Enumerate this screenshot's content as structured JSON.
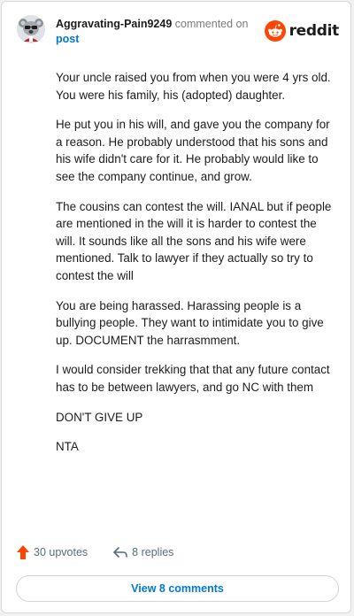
{
  "header": {
    "username": "Aggravating-Pain9249",
    "commented_text": "commented on",
    "post_link": "post",
    "brand": "reddit"
  },
  "comment": {
    "paragraphs": [
      "Your uncle raised you from when you were 4 yrs old. You were his family, his (adopted) daughter.",
      "He put you in his will, and gave you the company for a reason. He probably understood that his sons and his wife didn't care for it. He probably would like to see the company continue, and grow.",
      "The cousins can contest the will. IANAL but if people are mentioned in the will it is harder to contest the will. It sounds like all the sons and his wife were mentioned. Talk to lawyer if they actually so try to contest the will",
      "You are being harassed. Harassing people is a bullying people. They want to intimidate you to give up. DOCUMENT the harrasmment.",
      "I would consider trekking that that any future contact has to be between lawyers, and go NC with them",
      "DON'T GIVE UP",
      "NTA"
    ]
  },
  "actions": {
    "upvotes": "30 upvotes",
    "replies": "8 replies",
    "upvote_icon": "upvote-arrow-icon",
    "reply_icon": "reply-arrow-icon"
  },
  "footer": {
    "view_comments": "View 8 comments"
  },
  "colors": {
    "reddit_orange": "#ff4500",
    "link_blue": "#0079d3",
    "muted_text": "#576f76"
  }
}
